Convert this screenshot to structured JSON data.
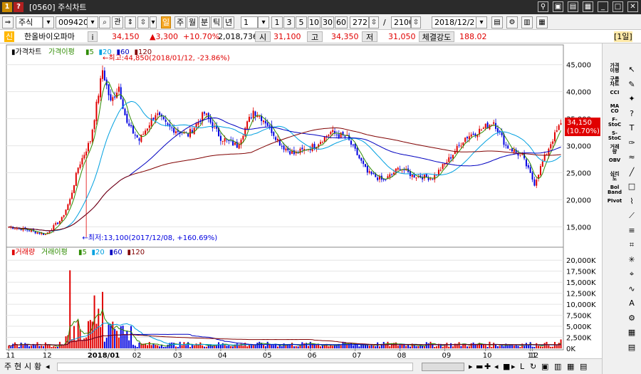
{
  "window": {
    "title": "[0560] 주식차트",
    "badge_left": "1",
    "badge_right": "?"
  },
  "toolbar": {
    "market": "주식",
    "code": "009420",
    "search_icon": "search-icon",
    "compare_label": "관",
    "periods": [
      "일",
      "주",
      "월",
      "분",
      "틱",
      "년"
    ],
    "interval_value": "1",
    "interval_buttons": [
      "1",
      "3",
      "5",
      "10",
      "30",
      "60"
    ],
    "count_value": "272",
    "total_value": "2100",
    "date_value": "2018/12/2"
  },
  "quote": {
    "badge": "신",
    "name": "한올바이오파마",
    "info_button": "i",
    "price": "34,150",
    "change": "▲3,300",
    "change_pct": "+10.70%",
    "volume": "2,018,736",
    "open_label": "시",
    "open": "31,100",
    "high_label": "고",
    "high": "34,350",
    "low_label": "저",
    "low": "31,050",
    "strength_label": "체결강도",
    "strength": "188.02",
    "period_tag": "[1일]"
  },
  "colors": {
    "up": "#e00000",
    "down": "#0000e0",
    "ma5": "#2e8b00",
    "ma20": "#00a0e0",
    "ma60": "#0000c0",
    "ma120": "#800000"
  },
  "right_tools": {
    "buttons": [
      "가격\n이평",
      "구름\n차트",
      "CCI",
      "MA\nCO",
      "F-\nStoC",
      "S-\nStoC",
      "거래\n량",
      "OBV",
      "심리\n도",
      "Bol\nBand",
      "PIvot"
    ],
    "icons": [
      "cursor-icon",
      "eraser-icon",
      "magic-icon",
      "help-icon",
      "text-icon",
      "pen-icon",
      "brush-icon",
      "line-icon",
      "rectangle-icon",
      "zigzag-icon",
      "fan-icon",
      "channel-icon",
      "fibonacci-icon",
      "gann-icon",
      "cycle-icon",
      "wave-icon",
      "auto-icon",
      "settings-icon",
      "grid-icon",
      "table-icon"
    ]
  },
  "status": {
    "tabs": [
      "주",
      "현",
      "시",
      "황"
    ]
  },
  "chart_data": [
    {
      "type": "candlestick",
      "legend": [
        "가격차트",
        "가격이평",
        "5",
        "20",
        "60",
        "120"
      ],
      "y_ticks": [
        "45,000",
        "40,000",
        "35,000",
        "30,000",
        "25,000",
        "20,000",
        "15,000"
      ],
      "ylim": [
        11500,
        47200
      ],
      "x_ticks": [
        "11",
        "12",
        "2018/01",
        "02",
        "03",
        "04",
        "05",
        "06",
        "07",
        "08",
        "09",
        "10",
        "11",
        "12"
      ],
      "annotations": {
        "high": "최고:44,850(2018/01/12, -23.86%)",
        "low": "최저:13,100(2017/12/08, +160.69%)",
        "last_price": "34,150",
        "last_pct": "(10.70%)"
      },
      "key_points": [
        {
          "date": "2017/11",
          "close": 15000
        },
        {
          "date": "2017/12/08",
          "low": 13100
        },
        {
          "date": "2018/01/12",
          "high": 44850
        },
        {
          "date": "2018/01/22",
          "close": 40000
        },
        {
          "date": "2018/03/10",
          "close": 33000
        },
        {
          "date": "2018/04/20",
          "close": 35000
        },
        {
          "date": "2018/05/15",
          "close": 28500
        },
        {
          "date": "2018/06/15",
          "close": 31500
        },
        {
          "date": "2018/07/10",
          "close": 24000
        },
        {
          "date": "2018/08/10",
          "close": 24500
        },
        {
          "date": "2018/09/20",
          "close": 33000
        },
        {
          "date": "2018/10/25",
          "close": 23000
        },
        {
          "date": "2018/11/25",
          "close": 31500
        },
        {
          "date": "2018/12/21",
          "close": 34150
        }
      ],
      "ma": {
        "ma5": "green",
        "ma20": "cyan",
        "ma60": "blue",
        "ma120": "brown"
      }
    },
    {
      "type": "bar",
      "legend": [
        "거래량",
        "거래이평",
        "5",
        "20",
        "60",
        "120"
      ],
      "y_ticks": [
        "20,000K",
        "17,500K",
        "15,000K",
        "12,500K",
        "10,000K",
        "7,500K",
        "5,000K",
        "2,500K",
        "0K"
      ],
      "ylim": [
        0,
        21000000
      ],
      "peaks": [
        {
          "date": "2017/12/20",
          "volume": 17700000
        },
        {
          "date": "2018/01/10",
          "volume": 12000000
        },
        {
          "date": "2018/01/12",
          "volume": 12800000
        },
        {
          "date": "2018/12/21",
          "volume": 2018736
        }
      ]
    }
  ]
}
